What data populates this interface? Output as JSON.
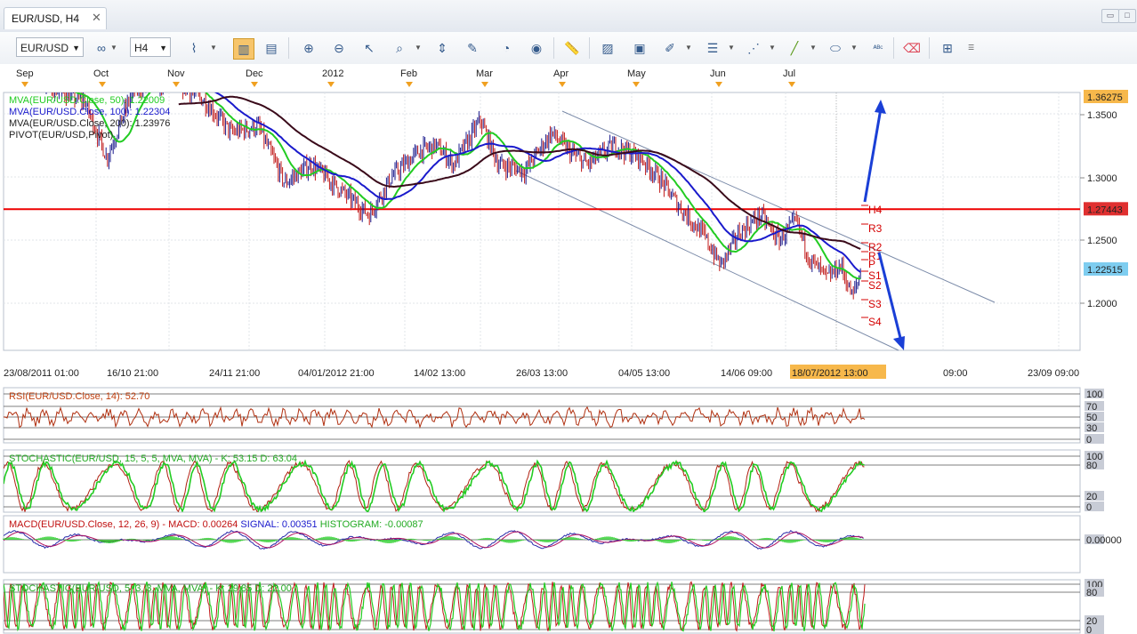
{
  "window": {
    "tab_title": "EUR/USD, H4",
    "close_glyph": "✕"
  },
  "toolbar": {
    "symbol": "EUR/USD",
    "timeframe": "H4",
    "icons": [
      "link-icon",
      "line-chart-icon",
      "bar-chart-icon",
      "candle-chart-icon",
      "zoom-in-icon",
      "zoom-out-icon",
      "cursor-icon",
      "zoom-select-icon",
      "fit-icon",
      "draw-icon",
      "indicator-icon",
      "globe-icon",
      "ruler-icon",
      "image-icon",
      "template-icon",
      "pen-icon",
      "lines-icon",
      "fib-icon",
      "trendline-icon",
      "ellipse-icon",
      "text-icon",
      "eraser-icon",
      "objects-icon"
    ]
  },
  "colors": {
    "green": "#22cc22",
    "blue": "#1a1acc",
    "maroon": "#3a0a1a",
    "red": "#ee0000",
    "arrow": "#1a3fd6",
    "price_box": "#f7b84b",
    "current_box": "#7ecdf0",
    "res_box": "#e03030"
  },
  "chart": {
    "months": [
      "Sep",
      "Oct",
      "Nov",
      "Dec",
      "2012",
      "Feb",
      "Mar",
      "Apr",
      "May",
      "Jun",
      "Jul"
    ],
    "time_labels": [
      "23/08/2011 01:00",
      "16/10 21:00",
      "24/11 21:00",
      "04/01/2012 21:00",
      "14/02 13:00",
      "26/03 13:00",
      "04/05 13:00",
      "14/06 09:00",
      "18/07/2012 13:00",
      "09:00",
      "23/09 09:00"
    ],
    "price_ticks": [
      "1.3500",
      "1.3000",
      "1.2500",
      "1.2000"
    ],
    "top_price": "1.36275",
    "red_line_price": "1.27443",
    "current_price": "1.22515",
    "legend": [
      "MVA(EUR/USD.Close, 50): 1.22009",
      "MVA(EUR/USD.Close, 100): 1.22304",
      "MVA(EUR/USD.Close, 200): 1.23976",
      "PIVOT(EUR/USD,Pivot)"
    ],
    "pivots": [
      "H4",
      "R3",
      "R2",
      "R1",
      "P",
      "S1",
      "S2",
      "S3",
      "S4"
    ]
  },
  "rsi": {
    "label": "RSI(EUR/USD.Close, 14): 52.70",
    "levels": [
      "100",
      "70",
      "50",
      "30",
      "0"
    ]
  },
  "stoch1": {
    "label": "STOCHASTIC(EUR/USD, 15, 5, 5, MVA, MVA) -  K: 53.15   D: 63.04",
    "levels": [
      "100",
      "80",
      "20",
      "0"
    ]
  },
  "macd": {
    "label_prefix": "MACD(EUR/USD.Close, 12, 26, 9) -",
    "macd": "MACD: 0.00264",
    "signal": "SIGNAL: 0.00351",
    "hist": "HISTOGRAM: -0.00087",
    "zero": "0.00000"
  },
  "stoch2": {
    "label": "STOCHASTIC(EUR/USD, 5, 3, 3, MVA, MVA) -  K: 29.85   D: 22.00",
    "levels": [
      "100",
      "80",
      "20",
      "0"
    ]
  }
}
